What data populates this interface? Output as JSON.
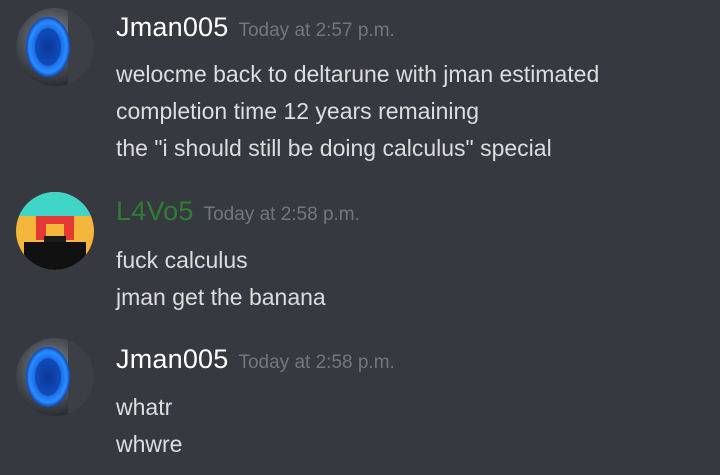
{
  "messages": [
    {
      "username": "Jman005",
      "timestamp": "Today at 2:57 p.m.",
      "avatar": "portal-sphere-avatar",
      "lines": [
        "welocme back to deltarune with jman estimated",
        "completion time 12 years remaining",
        "the \"i should still be doing calculus\" special"
      ]
    },
    {
      "username": "L4Vo5",
      "timestamp": "Today at 2:58 p.m.",
      "avatar": "pixel-face-avatar",
      "username_color": "#2e7d32",
      "lines": [
        "fuck calculus",
        "jman get the banana"
      ]
    },
    {
      "username": "Jman005",
      "timestamp": "Today at 2:58 p.m.",
      "avatar": "portal-sphere-avatar",
      "lines": [
        "whatr",
        "whwre"
      ]
    }
  ],
  "colors": {
    "background": "#36393f",
    "message_text": "#dcddde",
    "timestamp": "#72767d"
  }
}
